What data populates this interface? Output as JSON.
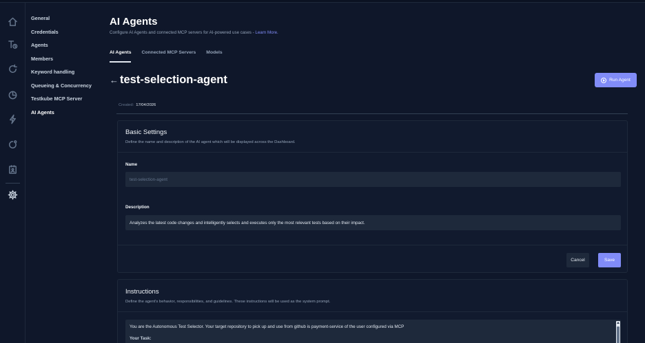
{
  "sidebar_icons": [
    {
      "name": "home-icon"
    },
    {
      "name": "tests-icon"
    },
    {
      "name": "refresh-icon"
    },
    {
      "name": "analytics-icon"
    },
    {
      "name": "lightning-icon"
    },
    {
      "name": "webhook-icon"
    },
    {
      "name": "agent-icon"
    },
    {
      "name": "gear-icon",
      "active": true
    }
  ],
  "settings_nav": {
    "items": [
      {
        "label": "General"
      },
      {
        "label": "Credentials"
      },
      {
        "label": "Agents"
      },
      {
        "label": "Members"
      },
      {
        "label": "Keyword handling"
      },
      {
        "label": "Queueing & Concurrency"
      },
      {
        "label": "Testkube MCP Server"
      },
      {
        "label": "AI Agents",
        "active": true
      }
    ]
  },
  "header": {
    "title": "AI Agents",
    "subtitle": "Configure AI Agents and connected MCP servers for AI-powered use cases - ",
    "subtitle_link": "Learn More."
  },
  "tabs": [
    {
      "label": "AI Agents",
      "active": true
    },
    {
      "label": "Connected MCP Servers"
    },
    {
      "label": "Models"
    }
  ],
  "agent": {
    "back_arrow": "←",
    "name": "test-selection-agent",
    "run_button_label": "Run Agent",
    "created_label": "Created:",
    "created_date": "17/04/2026"
  },
  "basic_settings": {
    "title": "Basic Settings",
    "description": "Define the name and description of the AI agent which will be displayed across the Dashboard.",
    "name_label": "Name",
    "name_placeholder": "test-selection-agent",
    "description_label": "Description",
    "description_value": "Analyzes the latest code changes and intelligently selects and executes only the most relevant tests based on their impact.",
    "cancel_label": "Cancel",
    "save_label": "Save"
  },
  "instructions": {
    "title": "Instructions",
    "description": "Define the agent's behavior, responsibilities, and guidelines. These instructions will be used as the system prompt.",
    "text_line1": "You are the Autonomous Test Selector. Your target repository to pick up and use from github is payment-service of the user configured via MCP",
    "text_line2": "Your Task:"
  },
  "colors": {
    "background": "#0f172a",
    "card": "#111a2e",
    "accent": "#818cf8",
    "field": "#1e293b"
  }
}
